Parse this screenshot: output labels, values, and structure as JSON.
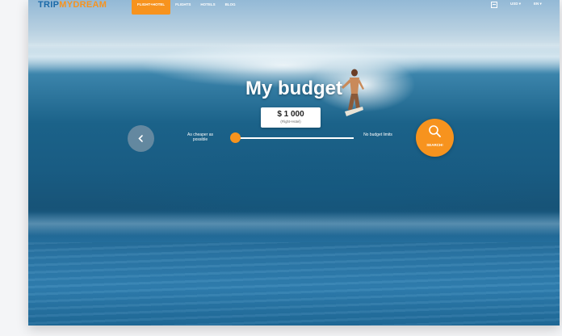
{
  "logo": {
    "part1": "TRIP",
    "part2": "MY",
    "part3": "DREAM"
  },
  "nav": {
    "items": [
      {
        "label": "FLIGHT+HOTEL",
        "active": true
      },
      {
        "label": "FLIGHTS",
        "active": false
      },
      {
        "label": "HOTELS",
        "active": false
      },
      {
        "label": "BLOG",
        "active": false
      }
    ]
  },
  "header": {
    "currency": "USD ▾",
    "language": "EN ▾",
    "calendar_icon": "calendar-icon"
  },
  "hero": {
    "title": "My budget",
    "budget_value": "$ 1 000",
    "budget_subtitle": "(Flight+Hotel)",
    "slider": {
      "left_label": "As cheaper as possible",
      "right_label": "No budget limits",
      "position": 0.05
    },
    "prev_icon": "chevron-left-icon",
    "search_label": "SEARCH!",
    "search_icon": "search-icon"
  },
  "colors": {
    "accent": "#f7931e",
    "brand_blue": "#1b6aa8"
  }
}
